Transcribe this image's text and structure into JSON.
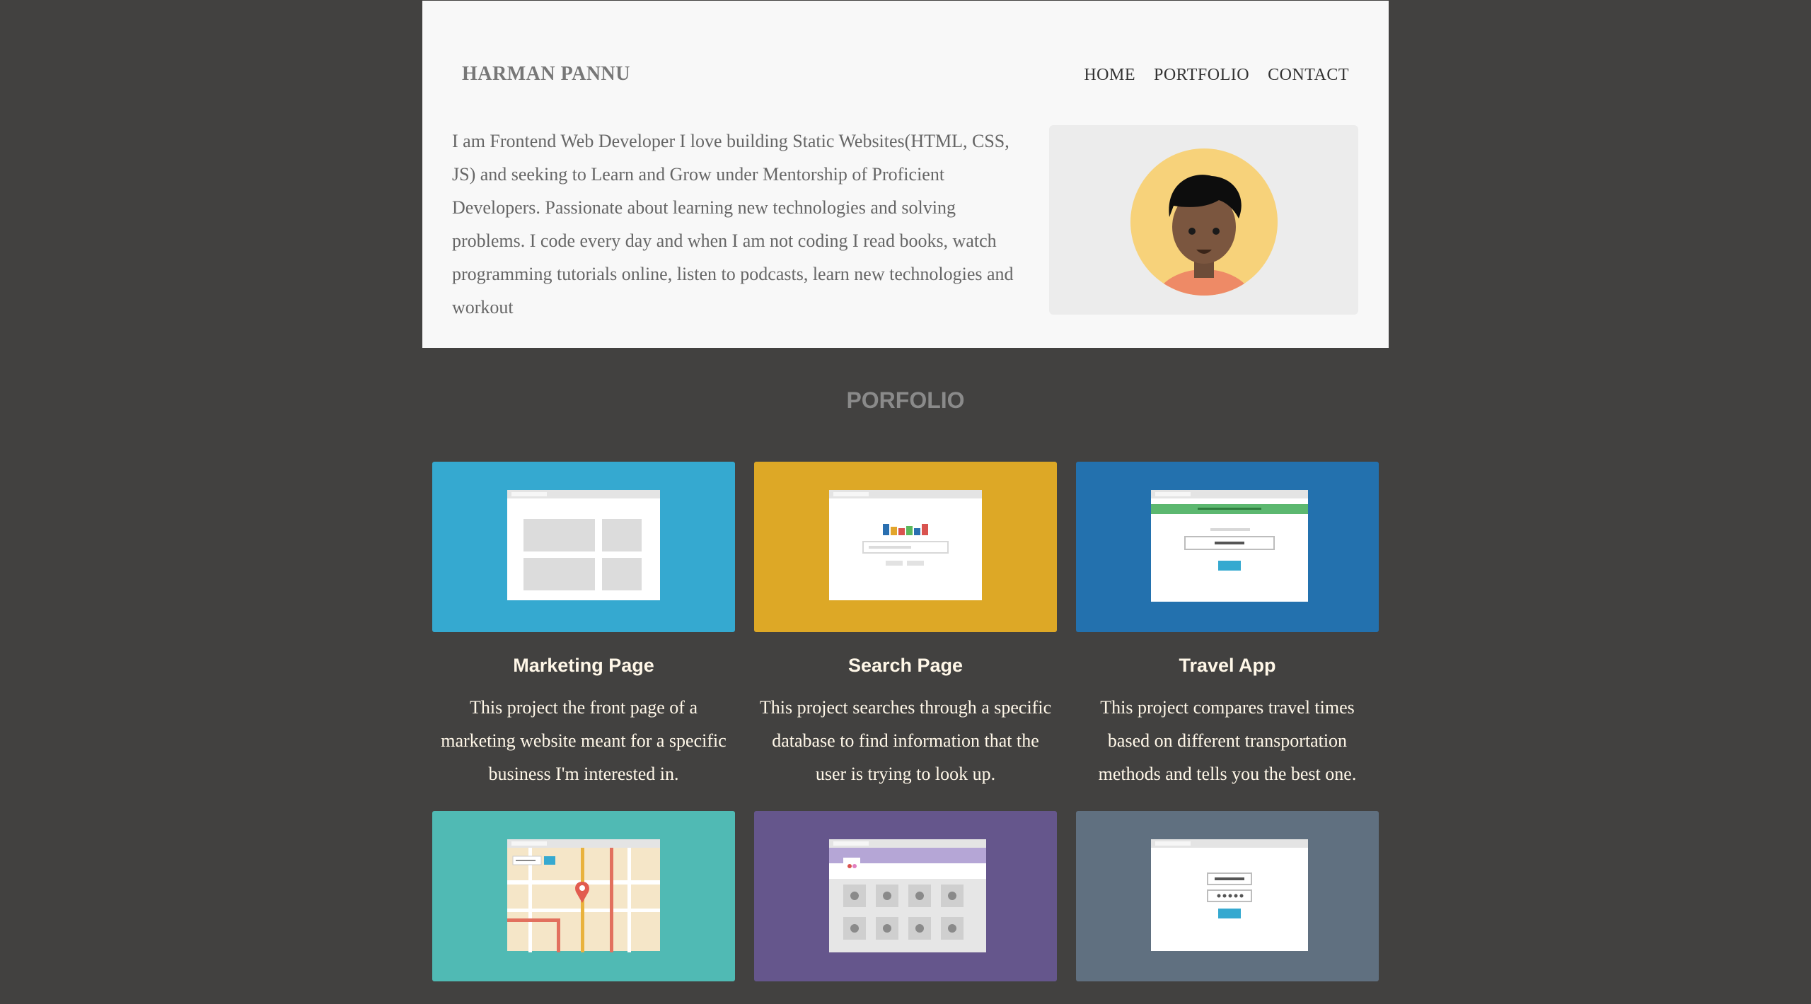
{
  "header": {
    "brand": "HARMAN PANNU",
    "nav": [
      "HOME",
      "PORTFOLIO",
      "CONTACT"
    ],
    "bio": "I am Frontend Web Developer I love building Static Websites(HTML, CSS, JS) and seeking to Learn and Grow under Mentorship of Proficient Developers. Passionate about learning new technologies and solving problems. I code every day and when I am not coding I read books, watch programming tutorials online, listen to podcasts, learn new technologies and workout"
  },
  "portfolio": {
    "title": "PORFOLIO",
    "projects": [
      {
        "title": "Marketing Page",
        "description": "This project the front page of a marketing website meant for a specific business I'm interested in.",
        "color": "#35a9d0"
      },
      {
        "title": "Search Page",
        "description": "This project searches through a specific database to find information that the user is trying to look up.",
        "color": "#dda826"
      },
      {
        "title": "Travel App",
        "description": "This project compares travel times based on different transportation methods and tells you the best one.",
        "color": "#2371ae"
      },
      {
        "title": "",
        "description": "",
        "color": "#50bab4"
      },
      {
        "title": "",
        "description": "",
        "color": "#65568c"
      },
      {
        "title": "",
        "description": "",
        "color": "#607080"
      }
    ]
  }
}
